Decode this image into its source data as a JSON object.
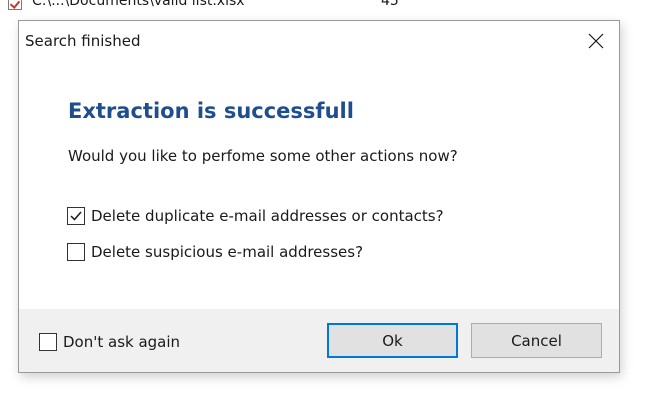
{
  "background_row": {
    "path": "C:\\...\\Documents\\valid list.xlsx",
    "count": "45"
  },
  "dialog": {
    "title": "Search finished",
    "heading": "Extraction is successfull",
    "question": "Would you like to perfome some other actions now?",
    "options": [
      {
        "label": "Delete duplicate e-mail addresses or contacts?",
        "checked": true
      },
      {
        "label": "Delete suspicious e-mail addresses?",
        "checked": false
      }
    ],
    "dont_ask_label": "Don't ask again",
    "dont_ask_checked": false,
    "ok_label": "Ok",
    "cancel_label": "Cancel"
  },
  "colors": {
    "heading": "#1f4e8c",
    "ok_focus_border": "#0078d7",
    "footer_bg": "#f0f0f0"
  },
  "icons": {
    "close": "close-icon",
    "check": "checkmark-icon",
    "file": "excel-file-icon"
  }
}
